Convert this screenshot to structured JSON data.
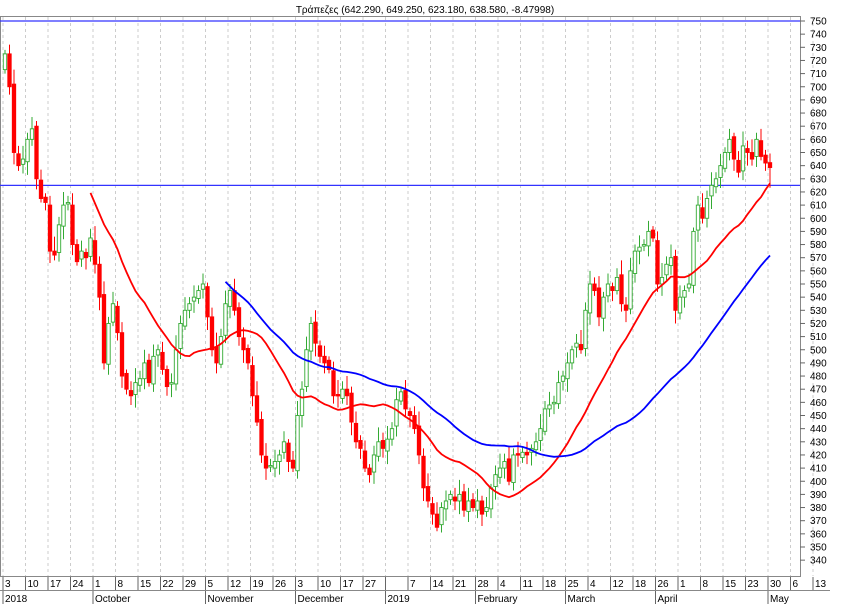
{
  "chart_data": {
    "type": "candlestick",
    "title": "Τράπεζες (642.290, 649.250, 623.180, 638.580, -8.47998)",
    "ylim": [
      340,
      750
    ],
    "y_ticks": [
      340,
      350,
      360,
      370,
      380,
      390,
      400,
      410,
      420,
      430,
      440,
      450,
      460,
      470,
      480,
      490,
      500,
      510,
      520,
      530,
      540,
      550,
      560,
      570,
      580,
      590,
      600,
      610,
      620,
      630,
      640,
      650,
      660,
      670,
      680,
      690,
      700,
      710,
      720,
      730,
      740,
      750
    ],
    "horizontal_lines": [
      750,
      625
    ],
    "week_labels": [
      "3",
      "10",
      "17",
      "24",
      "1",
      "8",
      "15",
      "22",
      "29",
      "5",
      "12",
      "19",
      "26",
      "3",
      "10",
      "17",
      "27",
      "",
      "7",
      "14",
      "21",
      "28",
      "4",
      "11",
      "18",
      "25",
      "4",
      "12",
      "18",
      "26",
      "1",
      "8",
      "15",
      "23",
      "30",
      "6",
      "13"
    ],
    "month_labels": [
      {
        "label": "2018",
        "week": 0
      },
      {
        "label": "October",
        "week": 4
      },
      {
        "label": "November",
        "week": 9
      },
      {
        "label": "December",
        "week": 13
      },
      {
        "label": "2019",
        "week": 17
      },
      {
        "label": "February",
        "week": 21
      },
      {
        "label": "March",
        "week": 25
      },
      {
        "label": "April",
        "week": 29
      },
      {
        "label": "May",
        "week": 34
      }
    ],
    "closes": [
      725,
      700,
      650,
      640,
      645,
      660,
      668,
      630,
      615,
      612,
      575,
      572,
      595,
      610,
      612,
      580,
      567,
      575,
      570,
      585,
      565,
      540,
      490,
      520,
      535,
      513,
      480,
      470,
      465,
      475,
      478,
      490,
      475,
      495,
      500,
      485,
      472,
      475,
      500,
      520,
      530,
      535,
      540,
      545,
      550,
      525,
      500,
      490,
      510,
      535,
      545,
      530,
      510,
      500,
      490,
      465,
      445,
      420,
      410,
      412,
      415,
      420,
      430,
      415,
      410,
      450,
      470,
      500,
      520,
      505,
      495,
      490,
      485,
      465,
      465,
      470,
      465,
      445,
      430,
      425,
      410,
      405,
      420,
      430,
      425,
      432,
      440,
      462,
      468,
      455,
      450,
      440,
      420,
      395,
      385,
      375,
      365,
      380,
      385,
      390,
      385,
      390,
      378,
      385,
      380,
      385,
      375,
      380,
      395,
      405,
      410,
      415,
      400,
      420,
      420,
      422,
      420,
      425,
      430,
      440,
      455,
      458,
      460,
      475,
      480,
      490,
      500,
      505,
      500,
      530,
      550,
      545,
      525,
      540,
      550,
      545,
      555,
      535,
      530,
      560,
      575,
      578,
      580,
      590,
      585,
      550,
      555,
      565,
      570,
      530,
      540,
      545,
      550,
      590,
      610,
      600,
      615,
      625,
      630,
      640,
      650,
      660,
      645,
      635,
      655,
      650,
      645,
      660,
      647,
      642,
      638.58
    ],
    "last_candle": {
      "open": 642.29,
      "high": 649.25,
      "low": 623.18,
      "close": 638.58,
      "change": -8.47998
    },
    "moving_averages": [
      {
        "period": 20,
        "color": "#ff0000"
      },
      {
        "period": 50,
        "color": "#0000ff"
      }
    ],
    "colors": {
      "up": "#33aa33",
      "down": "#ff0000",
      "line": "#3333ff"
    }
  }
}
